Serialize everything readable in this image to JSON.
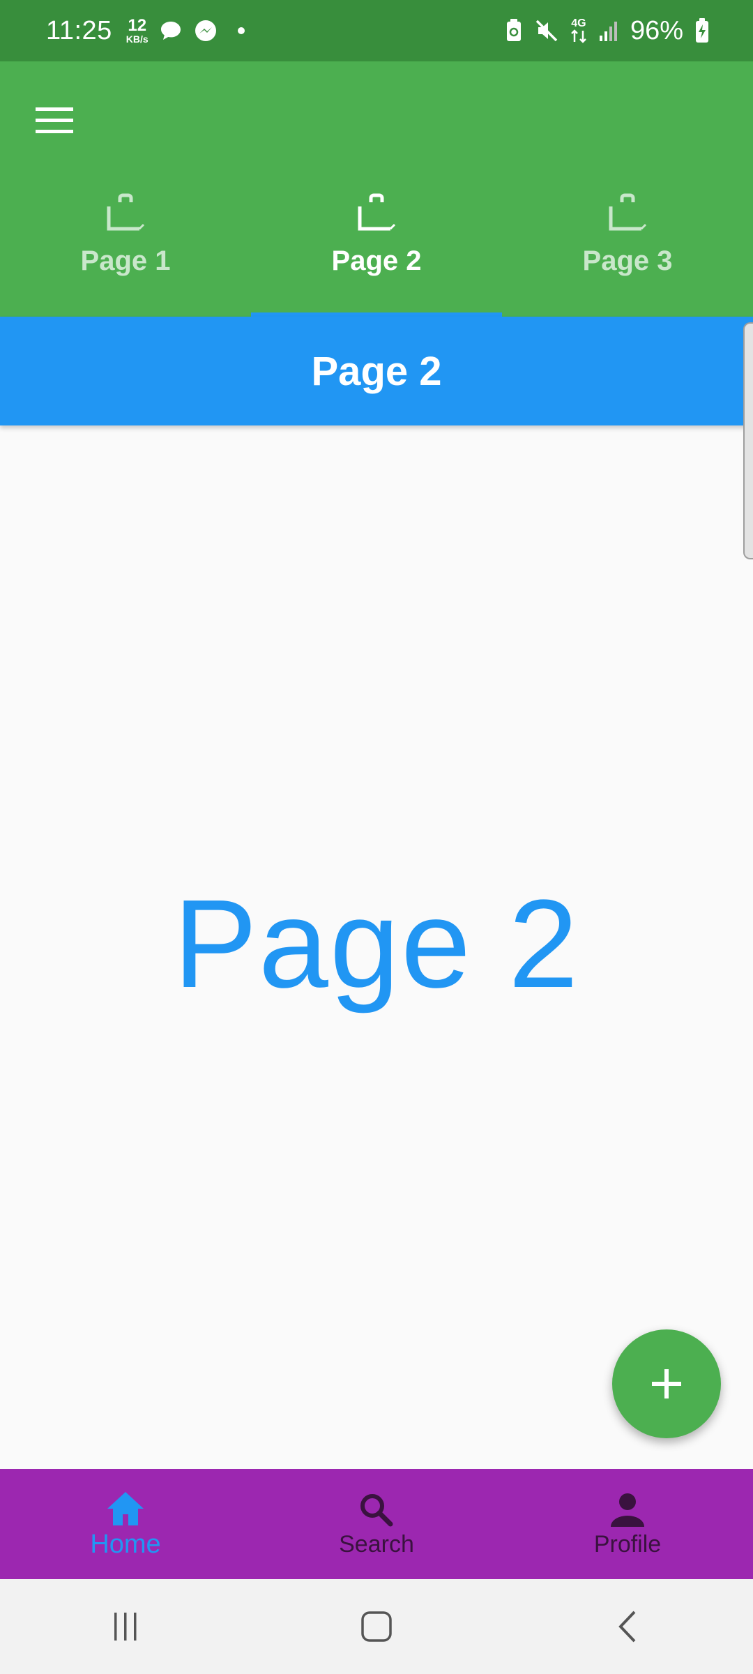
{
  "status_bar": {
    "time": "11:25",
    "speed_value": "12",
    "speed_unit": "KB/s",
    "network_type": "4G",
    "battery_percent": "96%"
  },
  "app_bar": {
    "menu_icon": "menu-icon",
    "tabs": [
      {
        "label": "Page 1",
        "icon": "bag-icon",
        "selected": false
      },
      {
        "label": "Page 2",
        "icon": "bag-icon",
        "selected": true
      },
      {
        "label": "Page 3",
        "icon": "bag-icon",
        "selected": false
      }
    ]
  },
  "sub_header": {
    "title": "Page 2"
  },
  "main": {
    "text": "Page 2"
  },
  "fab": {
    "icon": "plus-icon"
  },
  "bottom_nav": {
    "items": [
      {
        "label": "Home",
        "icon": "home-icon",
        "selected": true
      },
      {
        "label": "Search",
        "icon": "search-icon",
        "selected": false
      },
      {
        "label": "Profile",
        "icon": "person-icon",
        "selected": false
      }
    ]
  },
  "colors": {
    "status_bar": "#388e3c",
    "app_bar": "#4caf50",
    "accent_blue": "#2196f3",
    "bottom_nav": "#9c27b0",
    "fab": "#4caf50"
  }
}
